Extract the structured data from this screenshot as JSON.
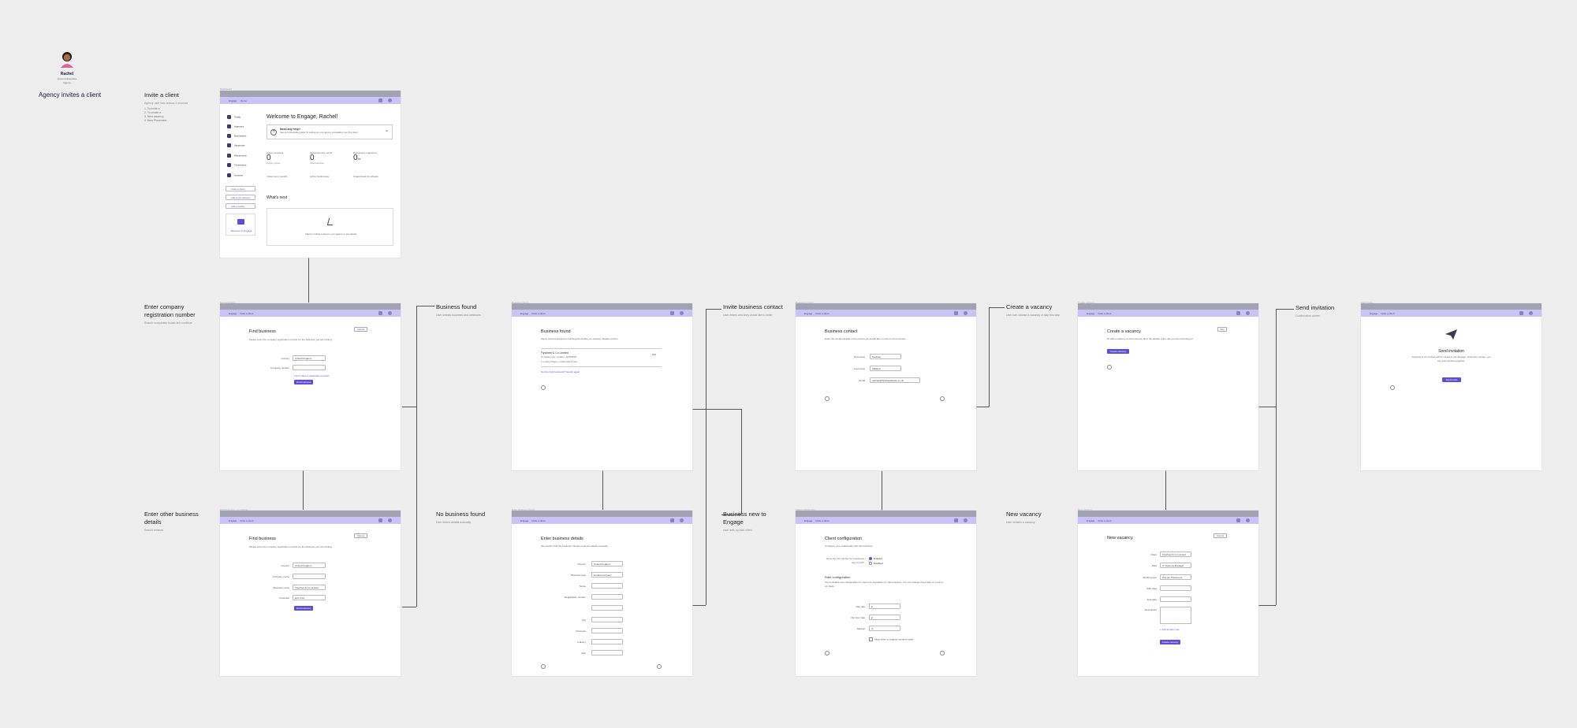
{
  "persona": {
    "name": "Rachel",
    "role_lines": [
      "Account Executive",
      "Agency"
    ],
    "flow_title": "Agency invites a client"
  },
  "steps": {
    "invite": {
      "title": "Invite a client",
      "sub": "Agency user has various 4 seconds",
      "list": [
        "1. To invite a",
        "2. To create a",
        "3. New vacancy",
        "4. New Placement"
      ]
    },
    "enter_crn": {
      "title": "Enter company registration number",
      "sub": "Search companies house and continue"
    },
    "business_found": {
      "title": "Business found",
      "sub": "User selects business and continues"
    },
    "invite_contact": {
      "title": "Invite business contact",
      "sub": "User enters who they would like to invite"
    },
    "create_vacancy": {
      "title": "Create a vacancy",
      "sub": "User can choose a vacancy or skip this step"
    },
    "send_invitation": {
      "title": "Send invitation",
      "sub": "Confirmation screen"
    },
    "enter_other": {
      "title": "Enter other business details",
      "sub": "Search reliance"
    },
    "no_business": {
      "title": "No business found",
      "sub": "User enters details manually"
    },
    "business_new": {
      "title": "Business new to Engage",
      "sub": "User sets up their client"
    },
    "new_vacancy": {
      "title": "New vacancy",
      "sub": "User creates a vacancy"
    }
  },
  "frames": {
    "dashboard": {
      "caption": "Dashboard",
      "nav": [
        "Engage",
        "Home"
      ],
      "sidebar": [
        "Today",
        "Agencies",
        "Businesses",
        "Vacancies",
        "Placements",
        "Timesheets",
        "Invoices"
      ],
      "side_buttons": [
        "Invite a client",
        "Add a job vacancy",
        "Add a worker"
      ],
      "support": "Welcome to Engage",
      "title": "Welcome to Engage, Rachel!",
      "help_title": "Need any help?",
      "help_text": "See our onboarding guide for setting up your agency and adding your first client",
      "stats": [
        {
          "label": "Active contracts",
          "value": "0",
          "sub": "Ongoing clients"
        },
        {
          "label": "Vacancies this month",
          "value": "0",
          "sub": "Open vacancies"
        },
        {
          "label": "Businesses registered",
          "value": "0",
          "sub": "%"
        }
      ],
      "stats2": [
        "Invites sent (month)",
        "Active businesses",
        "Unapproved timesheets"
      ],
      "whats_next": "What's next",
      "empty_text": "Start by inviting a client to your agency to get started"
    },
    "find_business": {
      "caption": "Find business",
      "nav": [
        "Engage",
        "Invite a client"
      ],
      "title": "Find business",
      "text": "Please enter the company registration number for the business you are inviting.",
      "cancel": "Cancel",
      "country_label": "Country",
      "country_value": "United Kingdom",
      "crn_label": "Company number",
      "link": "I don't have a registration number",
      "button": "Find business"
    },
    "business_found": {
      "caption": "Business found",
      "nav": [
        "Engage",
        "Invite a client"
      ],
      "title": "Business found",
      "text": "We've found a business matching the details you entered. Please confirm.",
      "company": "Flywheel & Co Limited",
      "company_no": "Company reg. number: 12345678",
      "address": "1 London Place, London EC1 1AA",
      "edit": "Edit",
      "not_right": "Not the right business? Search again"
    },
    "business_contact": {
      "caption": "Business contact",
      "nav": [
        "Engage",
        "Invite a client"
      ],
      "title": "Business contact",
      "text": "Enter the contact details of the person you would like to invite to the business.",
      "fields": [
        {
          "label": "First name",
          "value": "Rachael"
        },
        {
          "label": "Last name",
          "value": "Williams"
        },
        {
          "label": "Email",
          "value": "rachael@flywheelandco.co.uk"
        }
      ]
    },
    "create_vacancy": {
      "caption": "Create vacancy",
      "nav": [
        "Engage",
        "Invite a client"
      ],
      "title": "Create a vacancy",
      "text": "To add a vacancy to the business, fill in the details of the role you are recruiting for.",
      "skip": "Skip",
      "button": "Create vacancy"
    },
    "send_invitation": {
      "caption": "Send invite",
      "nav": [
        "Engage",
        "Invite a client"
      ],
      "title": "Send invitation",
      "text": "Flywheel & Co Limited will be invited to join Engage. Once they accept, you can start working together.",
      "button": "Send invite"
    },
    "find_business_other": {
      "caption": "Find business - no number",
      "nav": [
        "Engage",
        "Invite a client"
      ],
      "title": "Find business",
      "text": "Please enter the company registration number for the business you are inviting.",
      "cancel": "Cancel",
      "fields": [
        {
          "label": "Country",
          "value": "United Kingdom"
        },
        {
          "label": "Company name",
          "value": ""
        },
        {
          "label": "Business name",
          "value": "Flywheel & Co Limited"
        },
        {
          "label": "Postcode",
          "value": "EC1 1AA"
        }
      ],
      "button": "Find business"
    },
    "business_details": {
      "caption": "Enter business details",
      "nav": [
        "Engage",
        "Invite a client"
      ],
      "title": "Enter business details",
      "text": "We couldn't find the business. Please enter the details manually.",
      "fields": [
        {
          "label": "Country",
          "value": "United Kingdom"
        },
        {
          "label": "Business type",
          "value": "Limited company"
        },
        {
          "label": "Name",
          "value": ""
        },
        {
          "label": "Registration number",
          "value": ""
        },
        {
          "label": "",
          "value": ""
        },
        {
          "label": "City",
          "value": ""
        },
        {
          "label": "Postcode",
          "value": ""
        },
        {
          "label": "Industry",
          "value": ""
        },
        {
          "label": "Size",
          "value": ""
        }
      ]
    },
    "client_config": {
      "caption": "Client configuration",
      "nav": [
        "Engage",
        "Invite a client"
      ],
      "title": "Client configuration",
      "text": "Configure your relationship with this business.",
      "q_label": "Does the PO number for timesheets vary by job?",
      "opt1": "Enabled",
      "opt2": "Disabled",
      "rate_title": "Rate configuration",
      "rate_text": "Set up default rate configuration for payment negotiation for this business. You can change these later on a job by job basis.",
      "fields": [
        {
          "label": "Day rate",
          "value": "£"
        },
        {
          "label": "Per hour rate",
          "value": "£"
        },
        {
          "label": "Markup",
          "value": "%"
        }
      ],
      "checkbox": "Allow client to request overtime rates"
    },
    "new_vacancy": {
      "caption": "New vacancy",
      "nav": [
        "Engage",
        "Invite a client"
      ],
      "title": "New vacancy",
      "cancel": "Cancel",
      "fields": [
        {
          "label": "Client",
          "value": "Flywheel & Co Limited"
        },
        {
          "label": "Role",
          "value": "IT Systems Manager"
        },
        {
          "label": "Working type",
          "value": "Pay per Placement"
        },
        {
          "label": "Start date",
          "value": ""
        },
        {
          "label": "End date",
          "value": ""
        },
        {
          "label": "Description",
          "value": ""
        }
      ],
      "link": "+ Add another role",
      "button": "Create vacancy"
    }
  }
}
